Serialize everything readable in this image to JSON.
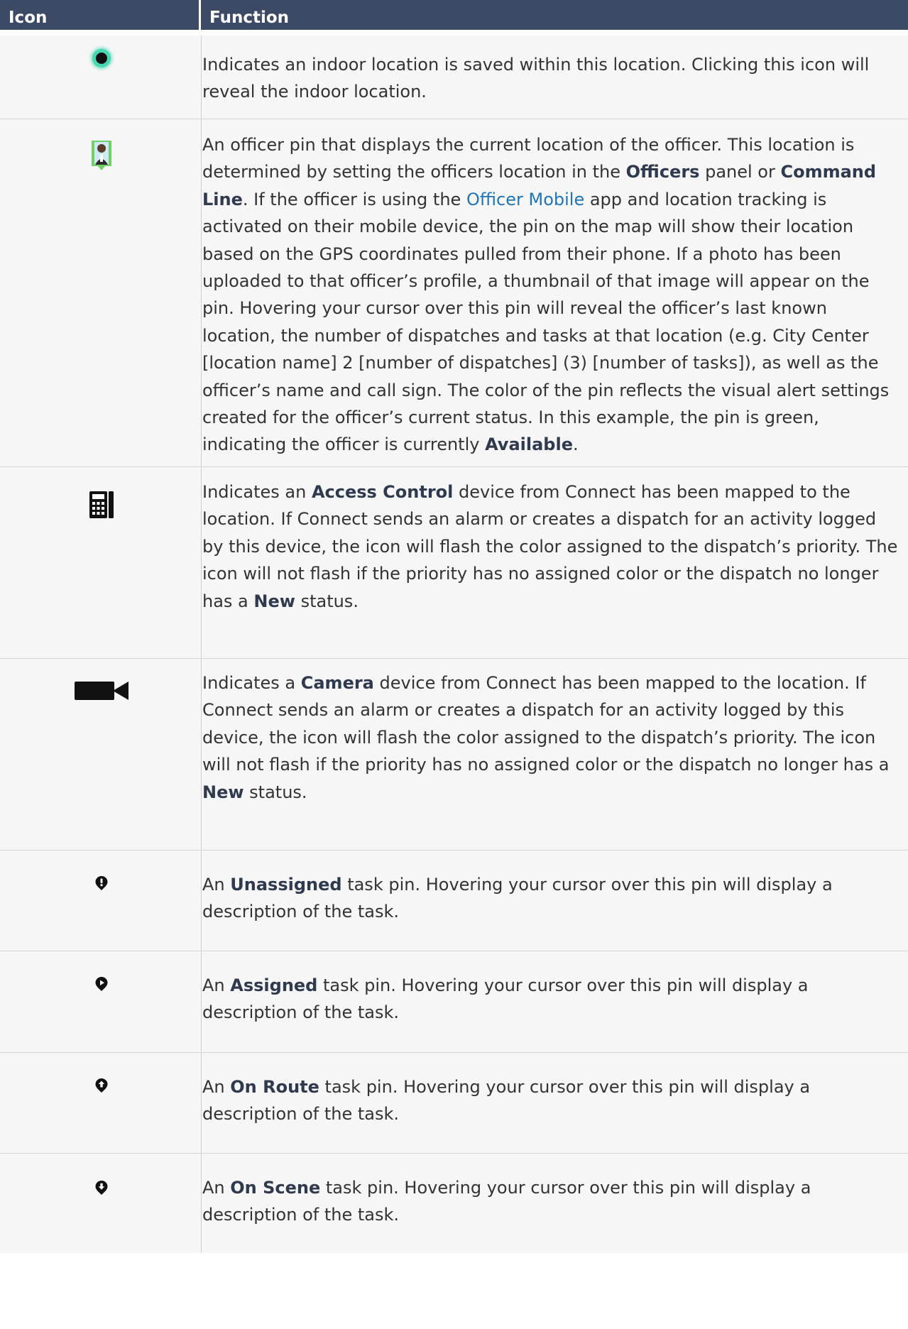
{
  "header": {
    "icon_label": "Icon",
    "function_label": "Function"
  },
  "colors": {
    "header_bg": "#3c4a66",
    "row_bg": "#f6f6f6",
    "link": "#1f75b8",
    "indoor_glow": "#46d8b0",
    "officer_available": "#6fd06a"
  },
  "rows": [
    {
      "icon": "indoor-location-icon",
      "text": [
        "Indicates an indoor location is saved within this location. Clicking this icon will reveal the indoor location."
      ]
    },
    {
      "icon": "officer-pin-icon",
      "parts": {
        "p1": "An officer pin that displays the current location of the officer. This location is determined by setting the officers location in the ",
        "b1": "Officers",
        "p2": " panel or ",
        "b2": "Command Line",
        "p3": ". If the officer is using the ",
        "link": "Officer Mobile",
        "p4": " app and location tracking is activated on their mobile device, the pin on the map will show their location based on the GPS coordinates pulled from their phone. If a photo has been uploaded to that officer’s profile, a thumbnail of that image will appear on the pin. Hovering your cursor over this pin will reveal the officer’s last known location, the number of dispatches and tasks at that location (e.g. City Center [location name] 2 [number of dispatches] (3) [number of tasks]), as well as the officer’s name and call sign. The color of the pin reflects the visual alert settings created for the officer’s current status. In this example, the pin is green, indicating the officer is currently ",
        "b3": "Available",
        "p5": "."
      }
    },
    {
      "icon": "access-control-icon",
      "parts": {
        "p1": "Indicates an ",
        "b1": "Access Control",
        "p2": " device from Connect has been mapped to the location. If Connect sends an alarm or creates a dispatch for an activity logged by this device, the icon will flash the color assigned to the dispatch’s priority. The icon will not flash if the priority has no assigned color or the dispatch no longer has a ",
        "b2": "New",
        "p3": " status."
      }
    },
    {
      "icon": "camera-icon",
      "parts": {
        "p1": "Indicates a ",
        "b1": "Camera",
        "p2": " device from Connect has been mapped to the location. If Connect sends an alarm or creates a dispatch for an activity logged by this device, the icon will flash the color assigned to the dispatch’s priority. The icon will not flash if the priority has no assigned color or the dispatch no longer has a ",
        "b2": "New",
        "p3": " status."
      }
    },
    {
      "icon": "unassigned-task-pin-icon",
      "parts": {
        "p1": "An ",
        "b1": "Unassigned",
        "p2": " task pin. Hovering your cursor over this pin will display a description of the task."
      }
    },
    {
      "icon": "assigned-task-pin-icon",
      "parts": {
        "p1": "An ",
        "b1": "Assigned",
        "p2": " task pin. Hovering your cursor over this pin will display a description of the task."
      }
    },
    {
      "icon": "on-route-task-pin-icon",
      "parts": {
        "p1": "An ",
        "b1": "On Route",
        "p2": " task pin. Hovering your cursor over this pin will display a description of the task."
      }
    },
    {
      "icon": "on-scene-task-pin-icon",
      "parts": {
        "p1": "An ",
        "b1": "On Scene",
        "p2": " task pin. Hovering your cursor over this pin will display a description of the task."
      }
    }
  ]
}
